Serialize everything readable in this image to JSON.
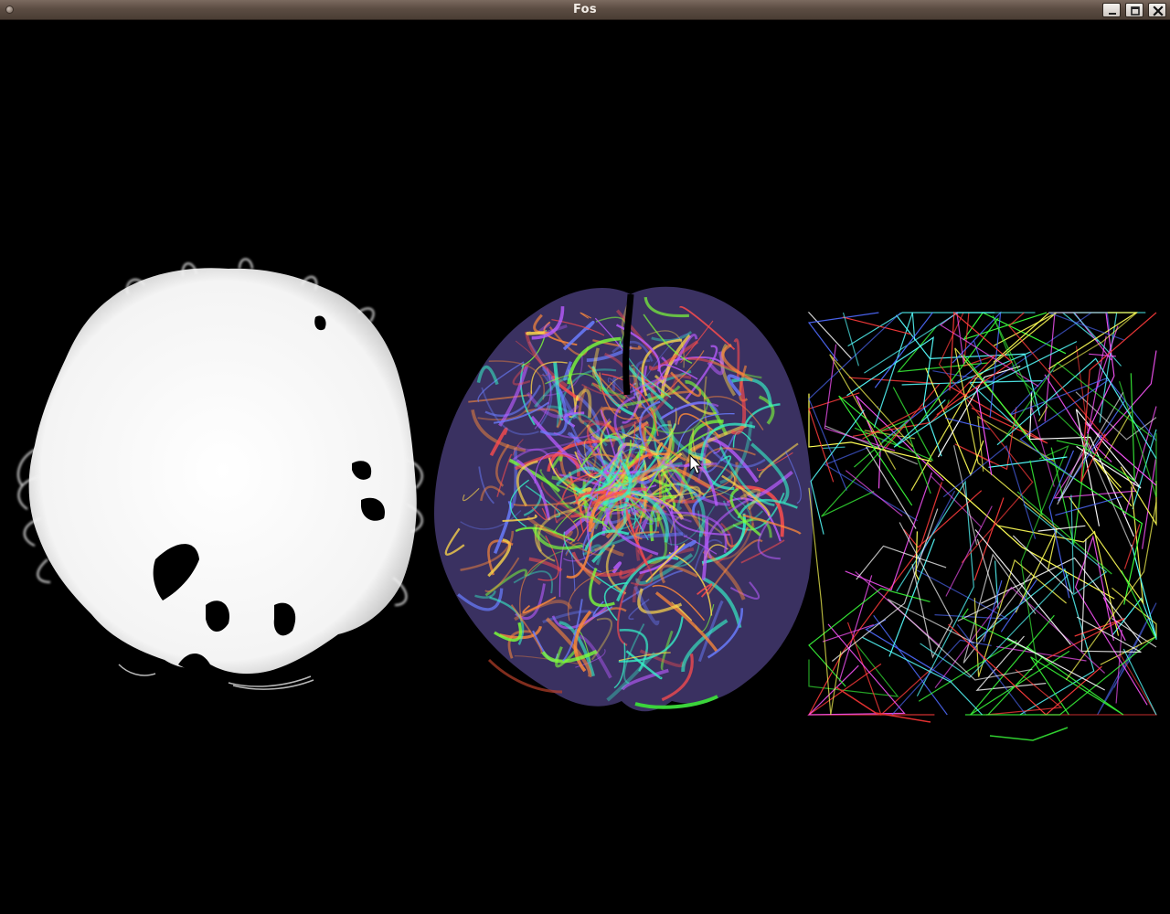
{
  "window": {
    "title": "Fos"
  },
  "titlebar_controls": {
    "menu_icon": "window-menu-icon",
    "minimize_icon": "minimize-icon",
    "maximize_icon": "maximize-icon",
    "close_icon": "close-icon"
  },
  "scene": {
    "background": "#000000",
    "panels": [
      {
        "name": "white-tractography",
        "color": "#f8f8f8"
      },
      {
        "name": "colored-tractography",
        "colors": [
          "#ff4d4d",
          "#b95cff",
          "#36f2c8",
          "#7cff3a",
          "#ff8a3a",
          "#6a7dff",
          "#ffd84a"
        ]
      },
      {
        "name": "sparse-streamlines",
        "colors": [
          "#ff3b3b",
          "#3bff3b",
          "#4f6bff",
          "#ffff55",
          "#ff55ff",
          "#55ffff",
          "#ffffff"
        ]
      }
    ]
  }
}
